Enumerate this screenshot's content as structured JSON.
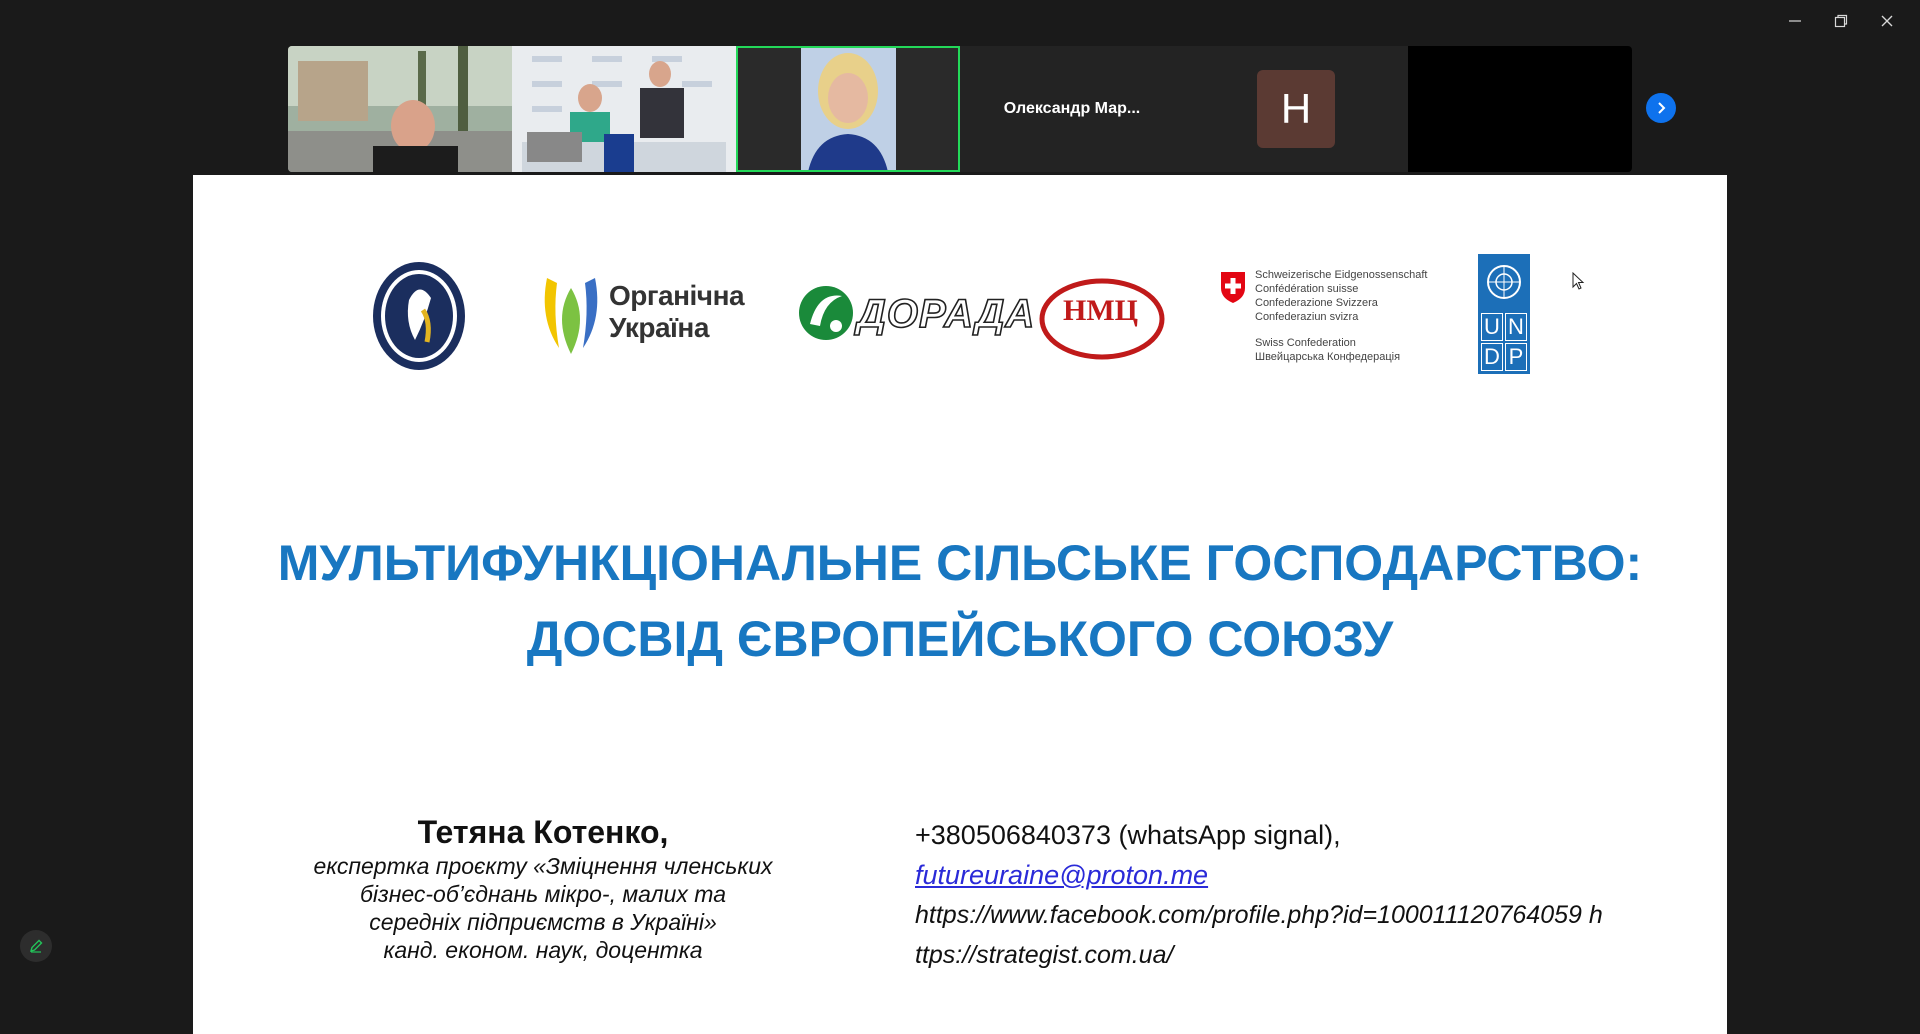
{
  "window": {
    "minimize_label": "—",
    "restore_label": "❐",
    "close_label": "✕"
  },
  "participants": [
    {
      "type": "video",
      "name": ""
    },
    {
      "type": "video",
      "name": ""
    },
    {
      "type": "video",
      "name": "",
      "active": true
    },
    {
      "type": "name",
      "name": "Олександр  Мар..."
    },
    {
      "type": "avatar",
      "initial": "Н"
    },
    {
      "type": "empty",
      "name": ""
    }
  ],
  "slide": {
    "logos": {
      "organic_line1": "Органічна",
      "organic_line2": "Україна",
      "dorada": "ДОРАДА",
      "nmc": "НМЦ",
      "swiss_lines": [
        "Schweizerische Eidgenossenschaft",
        "Confédération suisse",
        "Confederazione Svizzera",
        "Confederaziun svizra"
      ],
      "swiss_lines2": [
        "Swiss Confederation",
        "Швейцарська Конфедерація"
      ],
      "undp": [
        "U",
        "N",
        "D",
        "P"
      ]
    },
    "title_line1": "МУЛЬТИФУНКЦІОНАЛЬНЕ СІЛЬСЬКЕ ГОСПОДАРСТВО:",
    "title_line2": "ДОСВІД ЄВРОПЕЙСЬКОГО СОЮЗУ",
    "speaker_name": "Тетяна Котенко,",
    "speaker_desc": [
      "експертка проєкту «Зміцнення членських",
      "бізнес-об’єднань мікро-, малих та",
      "середніх підприємств в Україні»",
      "канд. економ. наук, доцентка"
    ],
    "phone": "+380506840373  (whatsApp signal),",
    "email": "futureuraine@proton.me",
    "facebook": "https://www.facebook.com/profile.php?id=100011120764059 h",
    "site": "ttps://strategist.com.ua/"
  }
}
